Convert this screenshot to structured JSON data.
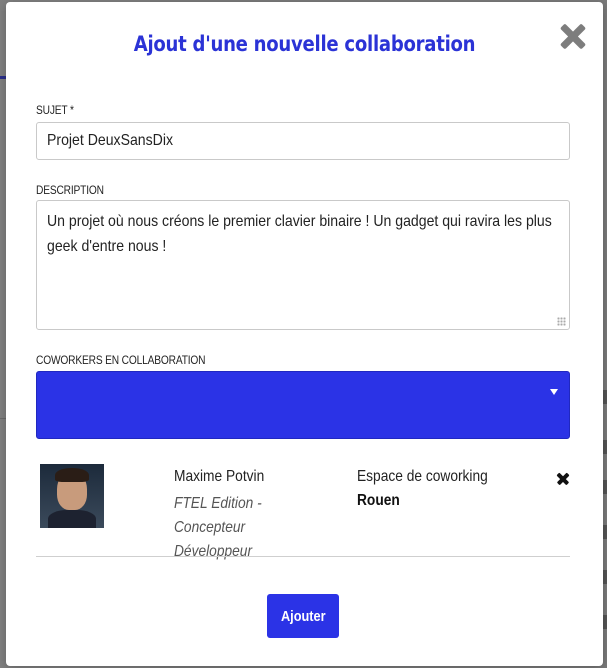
{
  "modal": {
    "title": "Ajout d'une nouvelle collaboration"
  },
  "form": {
    "subject": {
      "label": "SUJET",
      "required_mark": "*",
      "value": "Projet DeuxSansDix"
    },
    "description": {
      "label": "DESCRIPTION",
      "value": "Un projet où nous créons le premier clavier binaire ! Un gadget qui ravira  les plus geek d'entre nous !"
    },
    "coworkers": {
      "label": "COWORKERS EN COLLABORATION",
      "selected_value": "",
      "items": [
        {
          "name": "Maxime Potvin",
          "role": "FTEL Edition - Concepteur Développeur",
          "space_label": "Espace de coworking",
          "space_value": "Rouen"
        }
      ]
    },
    "submit_label": "Ajouter"
  },
  "colors": {
    "accent": "#2b33e6",
    "title": "#2b33d6",
    "overlay": "#7b7b7b"
  },
  "icons": {
    "close": "close-icon",
    "remove": "remove-icon",
    "dropdown": "chevron-down-icon"
  }
}
